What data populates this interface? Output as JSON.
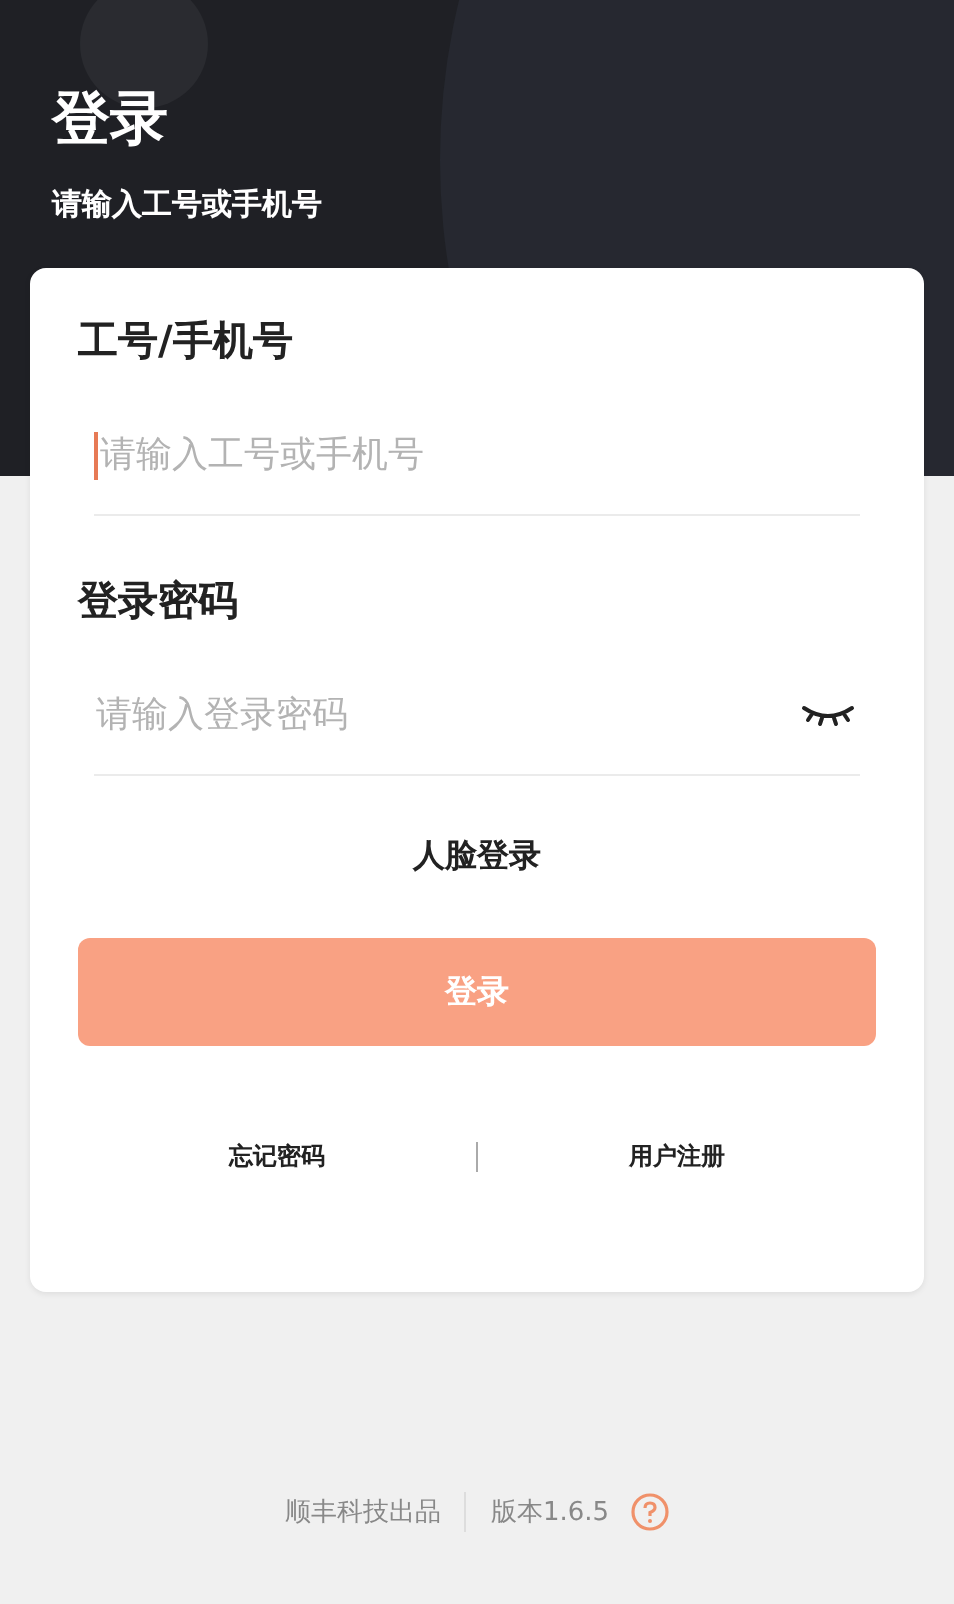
{
  "header": {
    "title": "登录",
    "subtitle": "请输入工号或手机号"
  },
  "fields": [
    {
      "kind": "text",
      "label": "工号/手机号",
      "placeholder": "请输入工号或手机号",
      "focused": true
    },
    {
      "kind": "password",
      "label": "登录密码",
      "placeholder": "请输入登录密码",
      "focused": false,
      "password_visible": false
    }
  ],
  "face_login": "人脸登录",
  "login_button": "登录",
  "links": [
    "忘记密码",
    "用户注册"
  ],
  "footer": {
    "company": "顺丰科技出品",
    "version": "版本1.6.5"
  }
}
